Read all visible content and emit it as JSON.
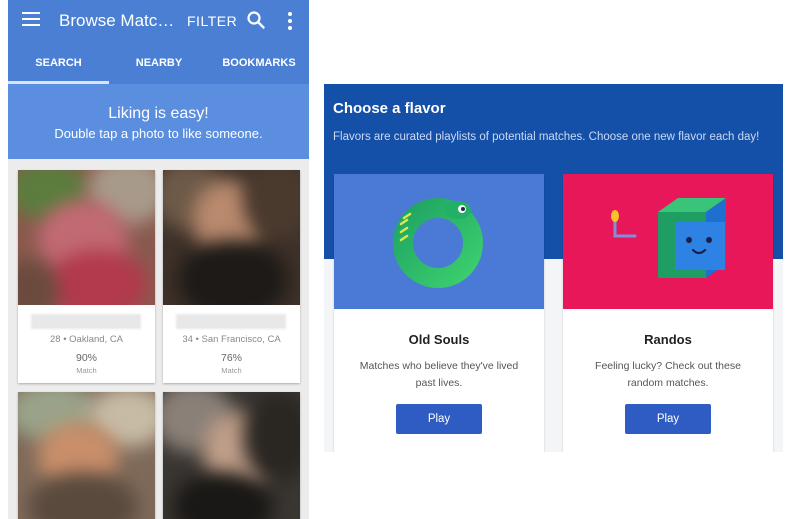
{
  "app_bar": {
    "title": "Browse Matc…",
    "filter_label": "FILTER",
    "menu_icon": "menu-icon",
    "search_icon": "search-icon",
    "more_icon": "more-vert-icon",
    "color": "#4a7fd4"
  },
  "tabs": [
    {
      "label": "SEARCH",
      "active": true
    },
    {
      "label": "NEARBY",
      "active": false
    },
    {
      "label": "BOOKMARKS",
      "active": false
    }
  ],
  "banner": {
    "title": "Liking is easy!",
    "subtitle": "Double tap a photo to like someone."
  },
  "matches": [
    {
      "location": "28 • Oakland, CA",
      "percent": "90%",
      "percent_label": "Match"
    },
    {
      "location": "34 • San Francisco, CA",
      "percent": "76%",
      "percent_label": "Match"
    },
    {
      "location": "",
      "percent": "",
      "percent_label": ""
    },
    {
      "location": "",
      "percent": "",
      "percent_label": ""
    }
  ],
  "flavors": {
    "title": "Choose a flavor",
    "description": "Flavors are curated playlists of potential matches. Choose one new flavor each day!",
    "header_color": "#1550a8",
    "items": [
      {
        "name": "Old Souls",
        "description": "Matches who believe they've lived past lives.",
        "button_label": "Play",
        "art_color": "#4a7ad6",
        "icon": "ouroboros-snake-icon"
      },
      {
        "name": "Randos",
        "description": "Feeling lucky? Check out these random matches.",
        "button_label": "Play",
        "art_color": "#e8175a",
        "icon": "cube-robot-icon"
      }
    ]
  }
}
